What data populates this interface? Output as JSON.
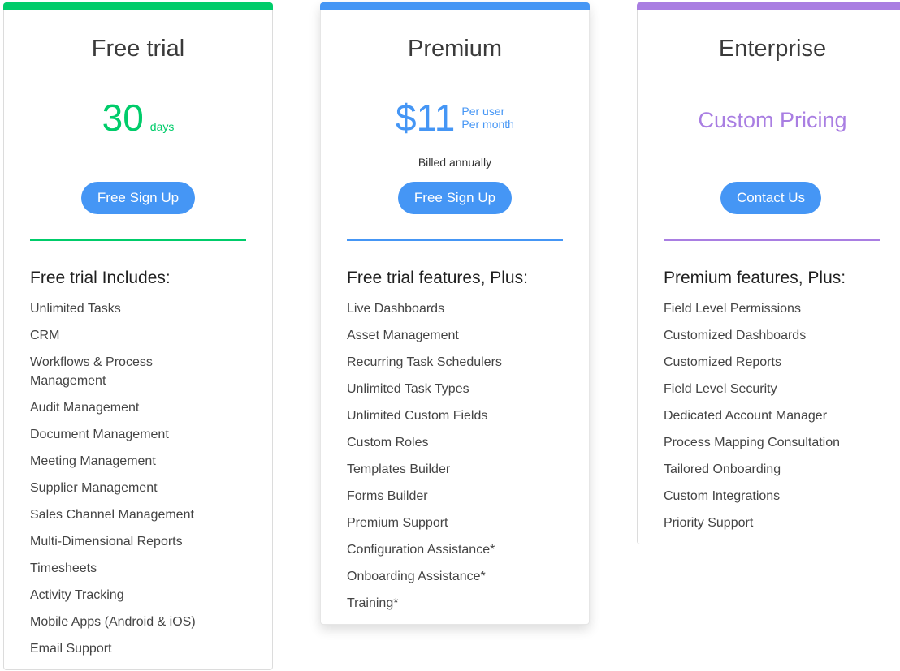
{
  "colors": {
    "free_accent": "#00cc6a",
    "premium_accent": "#4596f5",
    "enterprise_accent": "#a97ee2",
    "button_bg": "#4596f5"
  },
  "plans": [
    {
      "title": "Free trial",
      "price_value": "30",
      "price_unit": "days",
      "button_label": "Free Sign Up",
      "features_heading": "Free trial Includes:",
      "features": [
        "Unlimited Tasks",
        "CRM",
        "Workflows & Process Management",
        "Audit Management",
        "Document Management",
        "Meeting Management",
        "Supplier Management",
        "Sales Channel Management",
        "Multi-Dimensional Reports",
        "Timesheets",
        "Activity Tracking",
        "Mobile Apps (Android & iOS)",
        "Email Support"
      ]
    },
    {
      "title": "Premium",
      "price_value": "$11",
      "price_unit_line1": "Per user",
      "price_unit_line2": "Per month",
      "billing_note": "Billed annually",
      "button_label": "Free Sign Up",
      "features_heading": "Free trial features, Plus:",
      "features": [
        "Live Dashboards",
        "Asset Management",
        "Recurring Task Schedulers",
        "Unlimited Task Types",
        "Unlimited Custom Fields",
        "Custom Roles",
        "Templates Builder",
        "Forms Builder",
        "Premium Support",
        "Configuration Assistance*",
        "Onboarding Assistance*",
        "Training*"
      ]
    },
    {
      "title": "Enterprise",
      "price_text": "Custom Pricing",
      "button_label": "Contact Us",
      "features_heading": "Premium features, Plus:",
      "features": [
        "Field Level Permissions",
        "Customized Dashboards",
        "Customized Reports",
        "Field Level Security",
        "Dedicated Account Manager",
        "Process Mapping Consultation",
        "Tailored Onboarding",
        "Custom Integrations",
        "Priority Support"
      ]
    }
  ]
}
